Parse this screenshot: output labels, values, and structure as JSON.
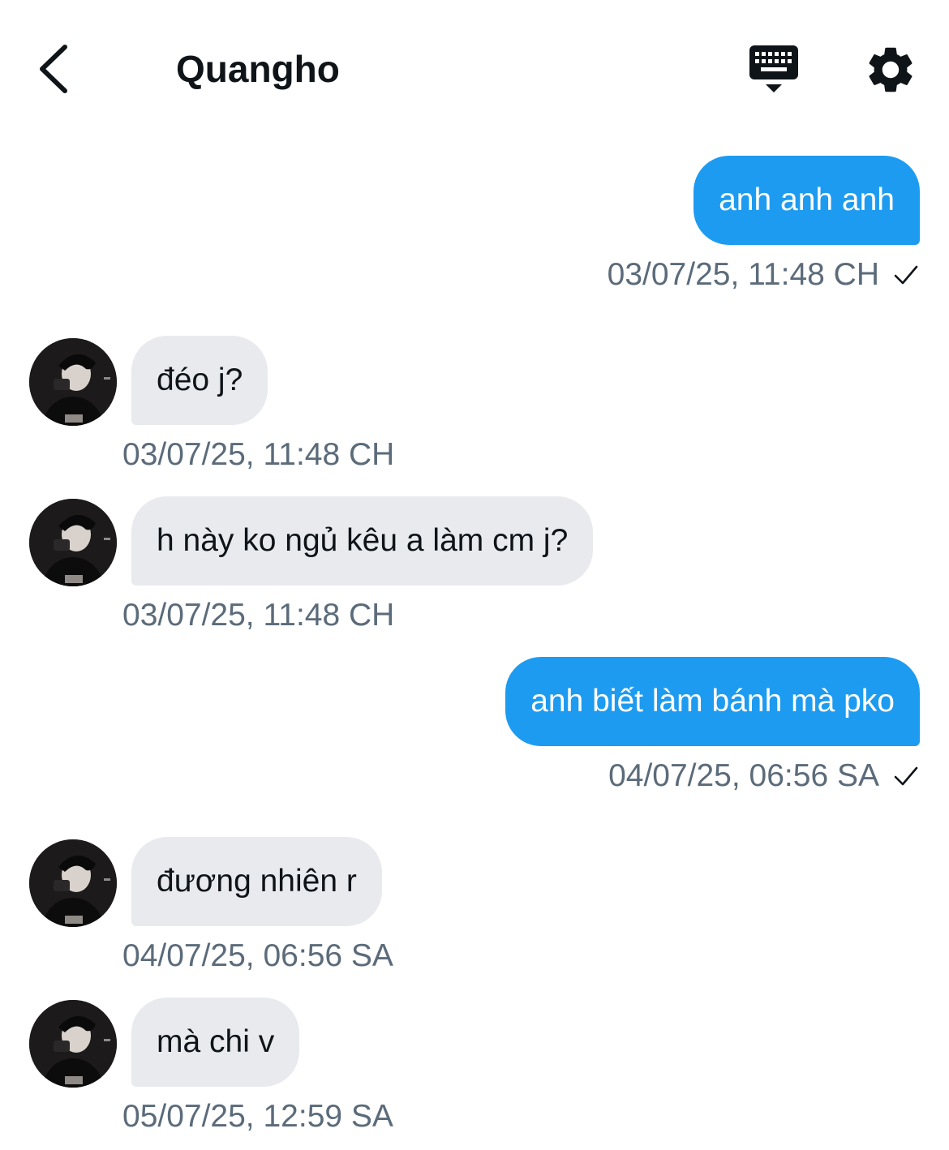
{
  "header": {
    "title": "Quangho",
    "back_icon": "chevron-left-icon",
    "keyboard_icon": "keyboard-icon",
    "settings_icon": "gear-icon"
  },
  "colors": {
    "outgoing_bubble": "#1d9bf0",
    "incoming_bubble": "#e8eaee",
    "timestamp": "#5b6b7a",
    "text": "#0f1419"
  },
  "messages": [
    {
      "direction": "outgoing",
      "text": "anh anh anh",
      "timestamp": "03/07/25, 11:48 CH",
      "status_icon": "check-icon"
    },
    {
      "direction": "incoming",
      "text": "đéo j?",
      "timestamp": "03/07/25, 11:48 CH"
    },
    {
      "direction": "incoming",
      "text": "h này ko ngủ kêu a làm cm j?",
      "timestamp": "03/07/25, 11:48 CH"
    },
    {
      "direction": "outgoing",
      "text": "anh biết làm bánh mà pko",
      "timestamp": "04/07/25, 06:56 SA",
      "status_icon": "check-icon"
    },
    {
      "direction": "incoming",
      "text": "đương nhiên r",
      "timestamp": "04/07/25, 06:56 SA"
    },
    {
      "direction": "incoming",
      "text": "mà chi v",
      "timestamp": "05/07/25, 12:59 SA"
    }
  ]
}
